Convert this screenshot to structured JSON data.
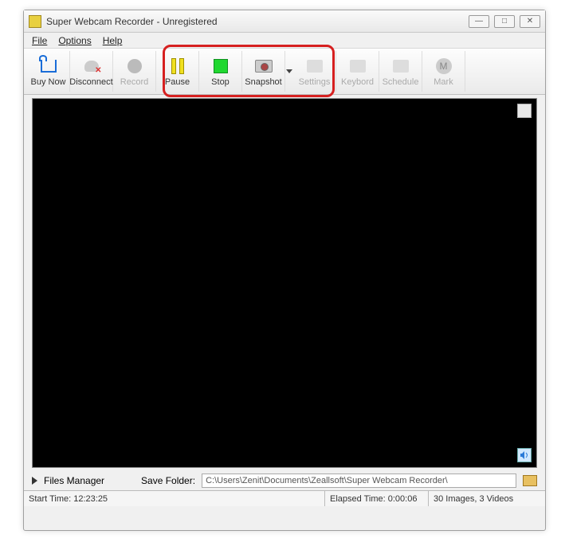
{
  "window": {
    "title": "Super Webcam Recorder - Unregistered"
  },
  "menu": {
    "file": "File",
    "options": "Options",
    "help": "Help"
  },
  "toolbar": {
    "buy": "Buy Now",
    "disconnect": "Disconnect",
    "record": "Record",
    "pause": "Pause",
    "stop": "Stop",
    "snapshot": "Snapshot",
    "settings": "Settings",
    "keyboard": "Keybord",
    "schedule": "Schedule",
    "mark": "Mark"
  },
  "files": {
    "manager": "Files Manager",
    "save_label": "Save Folder:",
    "path": "C:\\Users\\Zenit\\Documents\\Zeallsoft\\Super Webcam Recorder\\"
  },
  "status": {
    "start": "Start Time: 12:23:25",
    "elapsed": "Elapsed Time: 0:00:06",
    "counts": "30 Images, 3 Videos"
  }
}
